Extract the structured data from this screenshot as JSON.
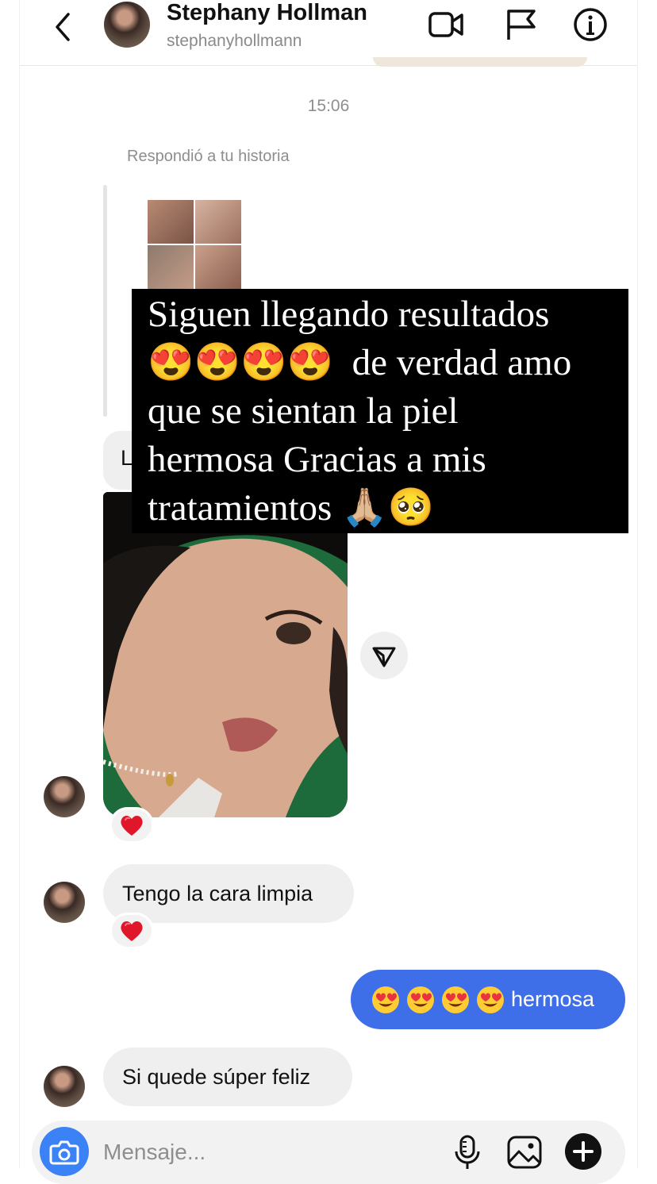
{
  "header": {
    "name": "Stephany Hollman",
    "username": "stephanyhollmann"
  },
  "thread": {
    "timestamp": "15:06",
    "reply_label": "Respondió a tu historia",
    "story_caption": "Siguen llegando resultados\n😍😍😍😍  de verdad amo\nque se sientan la piel\nhermosa Gracias a mis\ntratamientos 🙏🏼🥺",
    "partial_message_letter": "L",
    "messages": [
      {
        "from": "them",
        "type": "photo",
        "reaction": "❤️"
      },
      {
        "from": "them",
        "type": "text",
        "text": "Tengo la cara limpia",
        "reaction": "❤️"
      },
      {
        "from": "me",
        "type": "text",
        "text": "hermosa",
        "emoji_count": 4,
        "emoji": "😍"
      },
      {
        "from": "them",
        "type": "text",
        "text": "Si quede súper feliz"
      }
    ]
  },
  "composer": {
    "placeholder": "Mensaje..."
  },
  "colors": {
    "accent_blue": "#3f6fe8",
    "camera_blue": "#3b82f6",
    "bubble_grey": "#efefef",
    "reaction_red": "#e0162b"
  }
}
